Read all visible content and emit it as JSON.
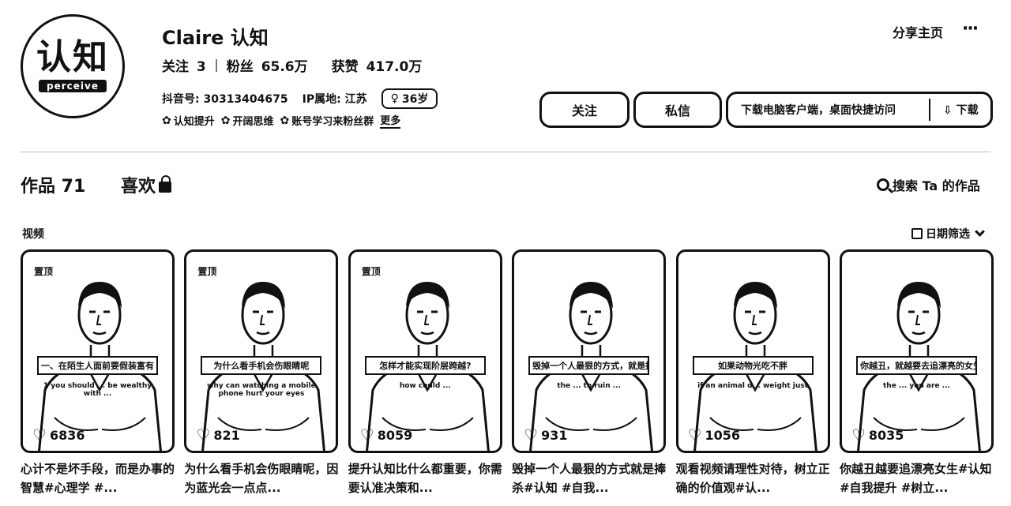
{
  "profile": {
    "avatar_text_cn": "认知",
    "avatar_text_en": "perceive",
    "name": "Claire 认知",
    "following_label": "关注",
    "following_count": "3",
    "followers_label": "粉丝",
    "followers_count": "65.6万",
    "likes_label": "获赞",
    "likes_count": "417.0万",
    "douyin_id": "抖音号: 30313404675",
    "ip_location": "IP属地: 江苏",
    "age": "36岁",
    "tags": [
      "认知提升",
      "开阔思维",
      "账号学习来粉丝群"
    ],
    "more_label": "更多"
  },
  "header": {
    "share_label": "分享主页",
    "more_icon": "···",
    "follow_label": "关注",
    "message_label": "私信",
    "download_hint": "下载电脑客户端，桌面快捷访问",
    "download_label": "下载"
  },
  "tabs": {
    "works_label": "作品 71",
    "likes_label": "喜欢",
    "search_label": "搜索 Ta 的作品"
  },
  "section": {
    "title": "视频",
    "filter_label": "日期筛选"
  },
  "videos": [
    {
      "pinned": "置顶",
      "subtitle": "一、在陌生人面前要假装富有",
      "subtitle_en": "1 you should ... be wealthy with ...",
      "likes": "6836",
      "caption": "心计不是坏手段，而是办事的智慧#心理学 #..."
    },
    {
      "pinned": "置顶",
      "subtitle": "为什么看手机会伤眼睛呢",
      "subtitle_en": "why can watching a mobile phone hurt your eyes",
      "likes": "821",
      "caption": "为什么看手机会伤眼睛呢，因为蓝光会一点点..."
    },
    {
      "pinned": "置顶",
      "subtitle": "怎样才能实现阶层跨越?",
      "subtitle_en": "how could ...",
      "likes": "8059",
      "caption": "提升认知比什么都重要，你需要认准决策和..."
    },
    {
      "pinned": "",
      "subtitle": "毁掉一个人最狠的方式，就是捧杀",
      "subtitle_en": "the ... to ruin ...",
      "likes": "931",
      "caption": "毁掉一个人最狠的方式就是捧杀#认知 #自我..."
    },
    {
      "pinned": "",
      "subtitle": "如果动物光吃不胖",
      "subtitle_en": "if an animal d... weight just",
      "likes": "1056",
      "caption": "观看视频请理性对待，树立正确的价值观#认..."
    },
    {
      "pinned": "",
      "subtitle": "你越丑，就越要去追漂亮的女生",
      "subtitle_en": "the ... you are ...",
      "likes": "8035",
      "caption": "你越丑越要追漂亮女生#认知 #自我提升 #树立..."
    }
  ]
}
